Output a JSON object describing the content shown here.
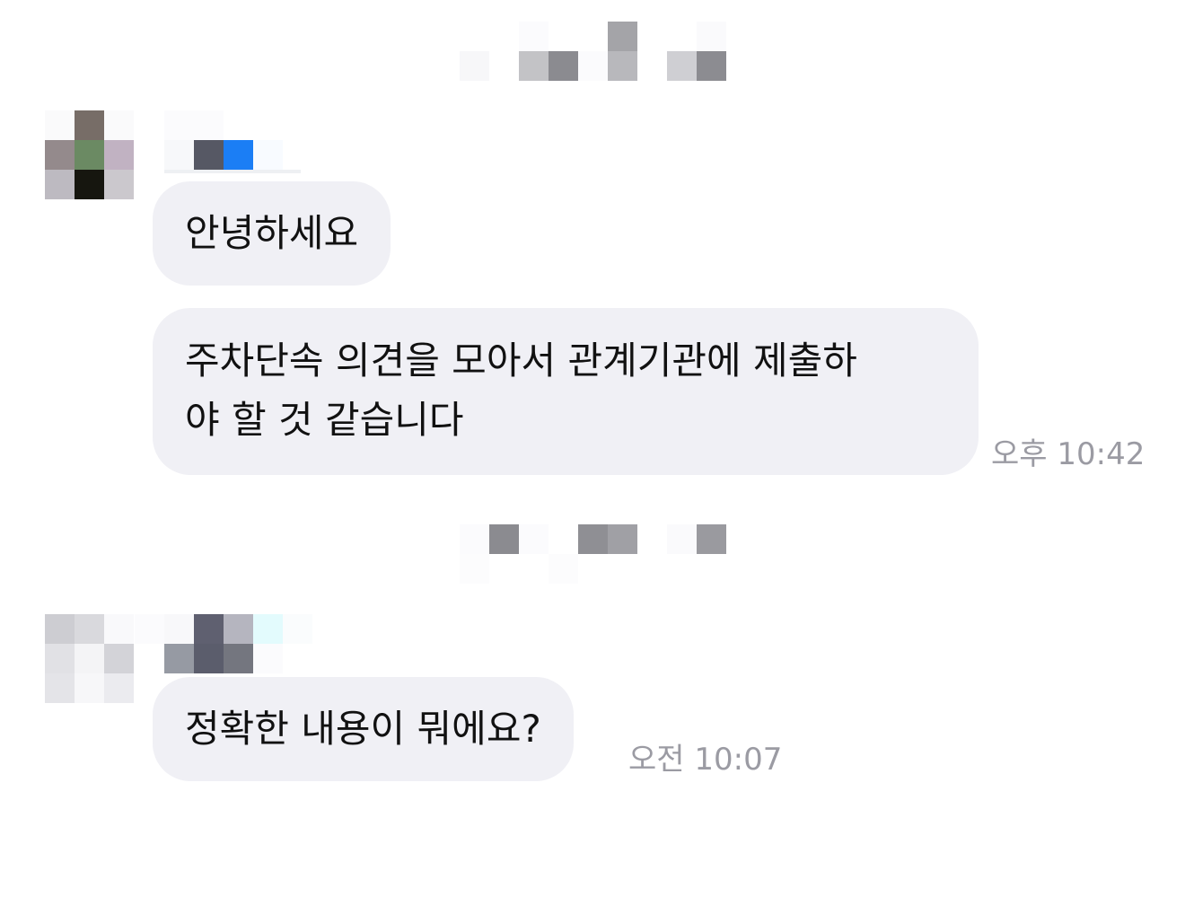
{
  "day_separators": [
    {
      "blurred": true
    },
    {
      "blurred": true
    }
  ],
  "messages": [
    {
      "sender_blurred": true,
      "bubbles": [
        {
          "lines": [
            "안녕하세요"
          ]
        },
        {
          "lines": [
            "주차단속 의견을 모아서 관계기관에 제출하",
            "야 할 것 같습니다"
          ]
        }
      ],
      "time": "오후 10:42"
    },
    {
      "sender_blurred": true,
      "bubbles": [
        {
          "lines": [
            "정확한 내용이 뭐에요?"
          ]
        }
      ],
      "time": "오전 10:07"
    }
  ],
  "colors": {
    "bubble_bg": "#f0f0f5",
    "bubble_text": "#111111",
    "timestamp": "#9b9ba3",
    "background": "#ffffff"
  }
}
